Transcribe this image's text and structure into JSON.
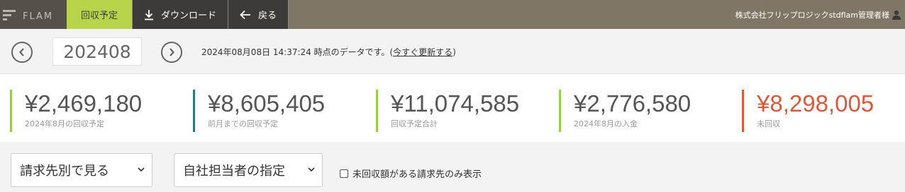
{
  "header": {
    "logo_text": "FLAM",
    "tabs": [
      {
        "label": "回収予定"
      },
      {
        "label": "ダウンロード"
      },
      {
        "label": "戻る"
      }
    ],
    "user_name": "株式会社フリップロジックstdflam管理者様"
  },
  "period": {
    "value": "202408",
    "timestamp_text": "2024年08月08日 14:37:24 時点のデータです。(",
    "refresh_link": "今すぐ更新する",
    "timestamp_close": ")"
  },
  "stats": [
    {
      "value": "¥2,469,180",
      "label": "2024年8月の回収予定"
    },
    {
      "value": "¥8,605,405",
      "label": "前月までの回収予定"
    },
    {
      "value": "¥11,074,585",
      "label": "回収予定合計"
    },
    {
      "value": "¥2,776,580",
      "label": "2024年8月の入金"
    },
    {
      "value": "¥8,298,005",
      "label": "未回収"
    }
  ],
  "filters": {
    "view_select": "請求先別で見る",
    "staff_select": "自社担当者の指定",
    "unpaid_only_label": "未回収額がある請求先のみ表示"
  },
  "colors": {
    "accent_green": "#b8d44a",
    "stat_green": "#9acb4f",
    "stat_teal": "#2f7a76",
    "stat_red": "#e0583a"
  }
}
